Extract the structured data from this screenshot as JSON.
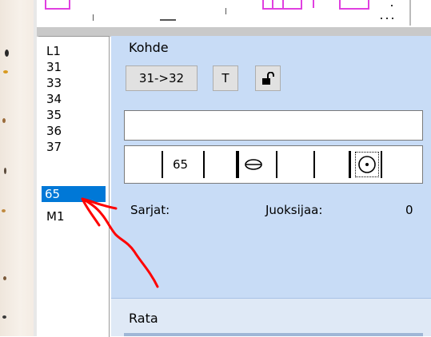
{
  "list": {
    "items": [
      "L1",
      "31",
      "33",
      "34",
      "35",
      "36",
      "37",
      "65",
      "M1"
    ],
    "selected": "65"
  },
  "kohde": {
    "title": "Kohde",
    "route_button": "31->32",
    "t_button": "T",
    "lock_icon": "unlocked-padlock-icon",
    "text_value": "",
    "strip": {
      "number": "65",
      "oval_icon": "oval-icon",
      "circle_dot_icon": "circle-dot-icon"
    }
  },
  "stats": {
    "sarjat_label": "Sarjat:",
    "juoksijaa_label": "Juoksijaa:",
    "juoksijaa_value": "0"
  },
  "rata": {
    "title": "Rata"
  },
  "annotation": {
    "color": "#ff0000",
    "type": "hand-drawn-red-arrow"
  }
}
